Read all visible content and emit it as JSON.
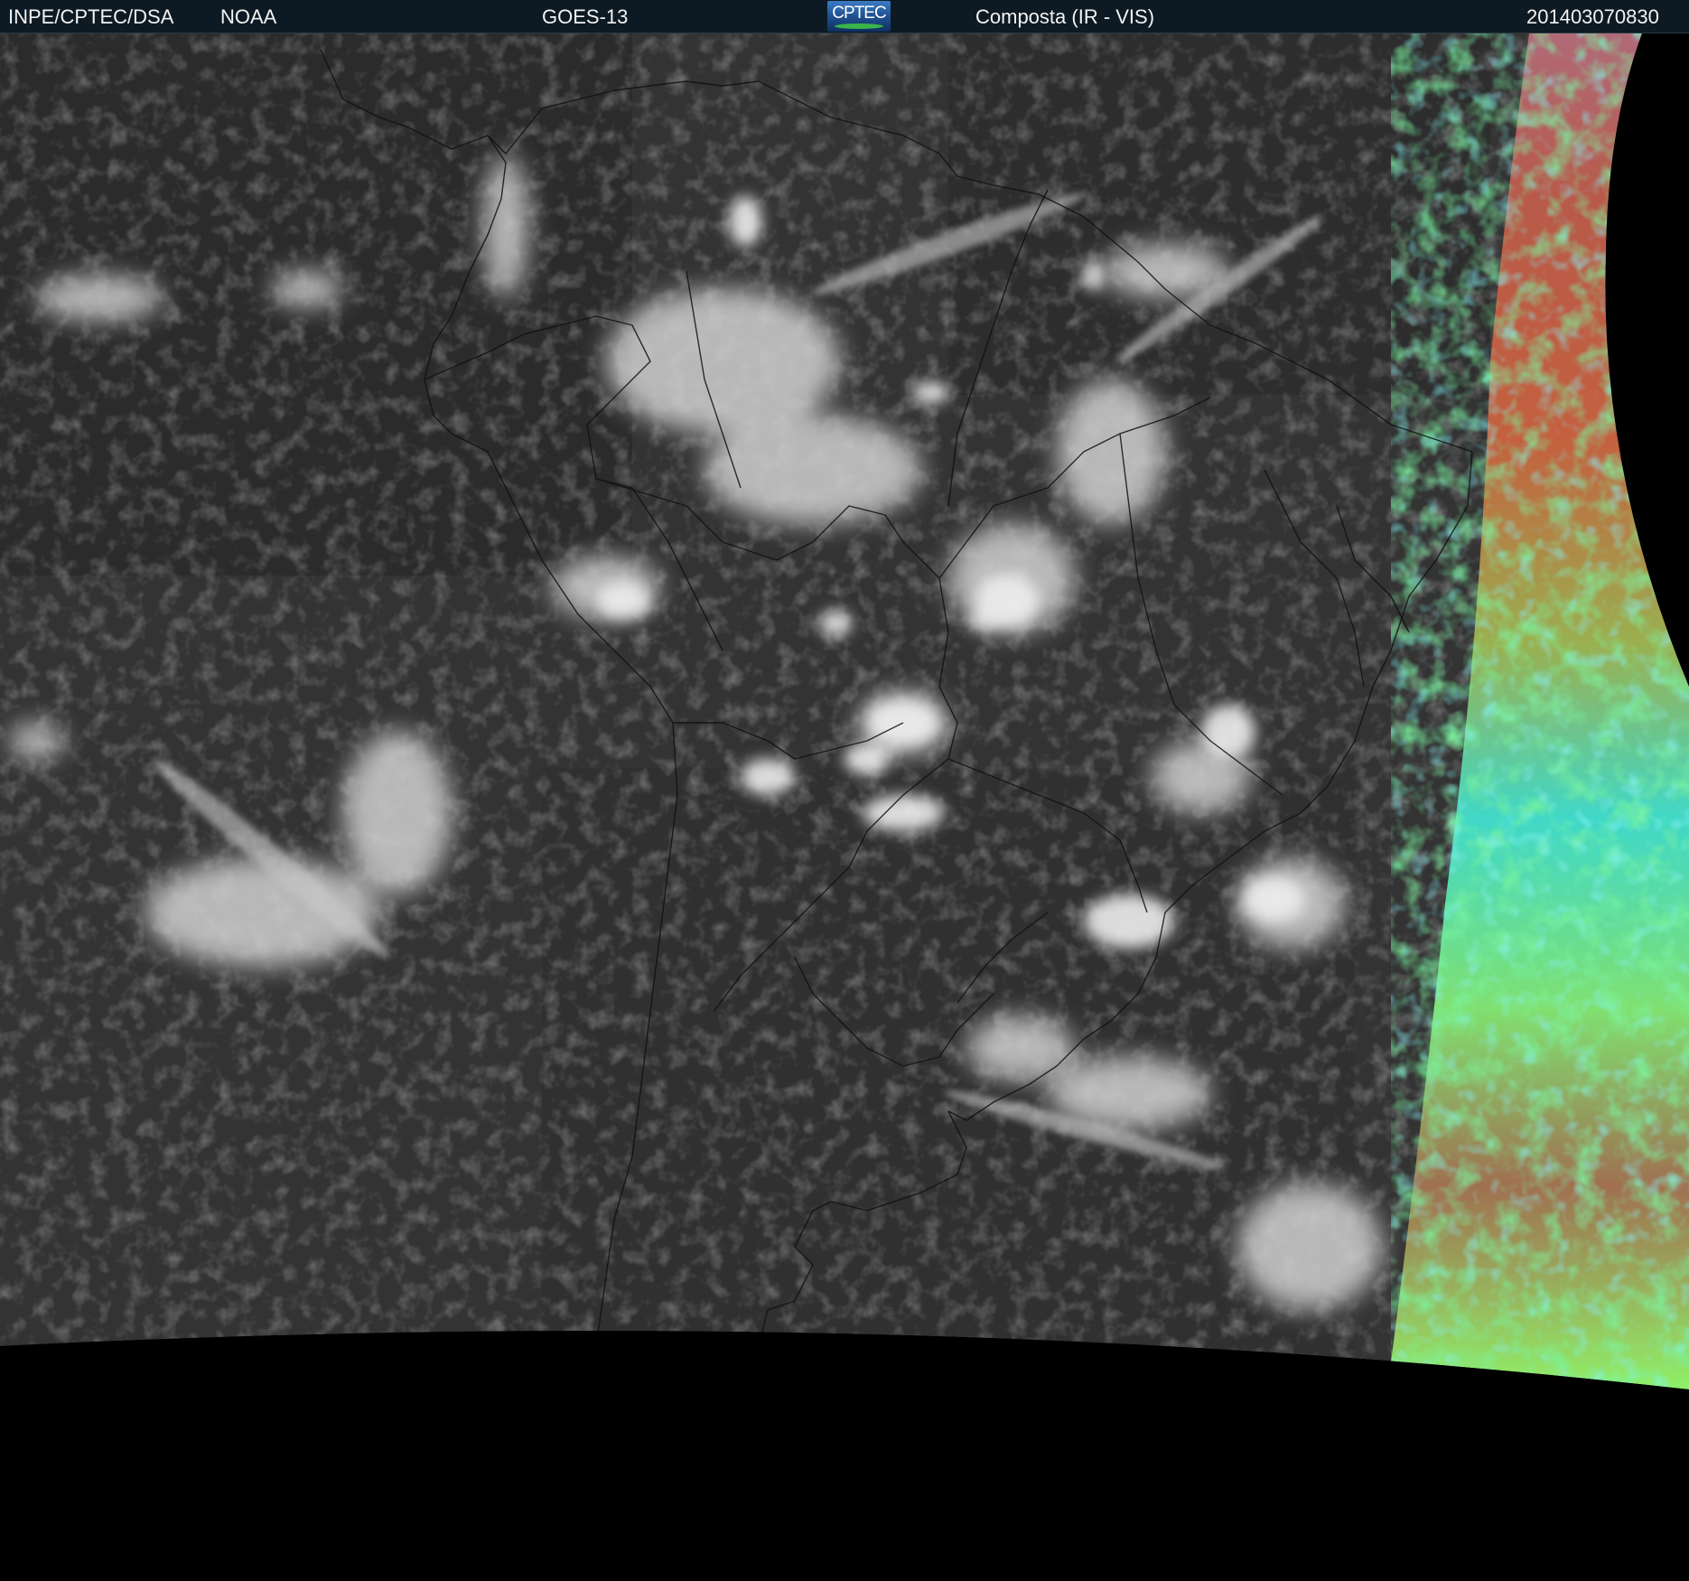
{
  "header": {
    "agency": "INPE/CPTEC/DSA",
    "source": "NOAA",
    "satellite": "GOES-13",
    "logo_text": "CPTEC",
    "product": "Composta (IR - VIS)",
    "timestamp": "201403070830"
  },
  "colors": {
    "header_bg": "#0d1a24",
    "ir_gray": "#3a3a3a",
    "cloud": "#d8d8d8",
    "space": "#000000",
    "vis_red": "#c0604a",
    "vis_green": "#8cf070",
    "vis_cyan": "#40e8e0"
  },
  "icons": {
    "logo": "cptec-logo"
  }
}
